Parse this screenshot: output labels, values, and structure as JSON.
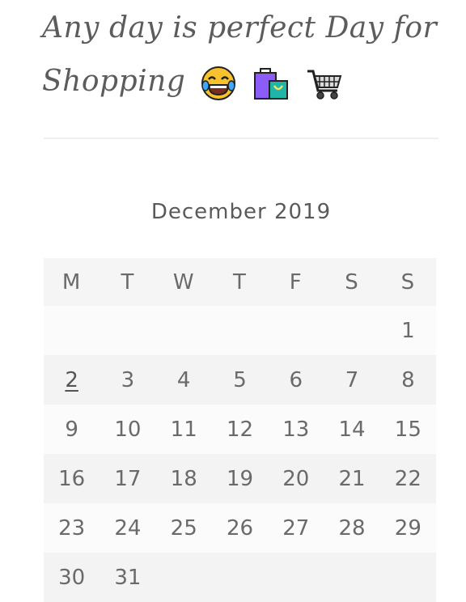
{
  "title": {
    "line1": "Any day is perfect Day for",
    "line2": "Shopping"
  },
  "emojis": [
    "laughing-tears-emoji",
    "shopping-bags-emoji",
    "shopping-cart-emoji"
  ],
  "calendar": {
    "caption": "December 2019",
    "weekdays": [
      "M",
      "T",
      "W",
      "T",
      "F",
      "S",
      "S"
    ],
    "weeks": [
      [
        "",
        "",
        "",
        "",
        "",
        "",
        "1"
      ],
      [
        "2",
        "3",
        "4",
        "5",
        "6",
        "7",
        "8"
      ],
      [
        "9",
        "10",
        "11",
        "12",
        "13",
        "14",
        "15"
      ],
      [
        "16",
        "17",
        "18",
        "19",
        "20",
        "21",
        "22"
      ],
      [
        "23",
        "24",
        "25",
        "26",
        "27",
        "28",
        "29"
      ],
      [
        "30",
        "31",
        "",
        "",
        "",
        "",
        ""
      ]
    ],
    "linked_day": "2"
  }
}
